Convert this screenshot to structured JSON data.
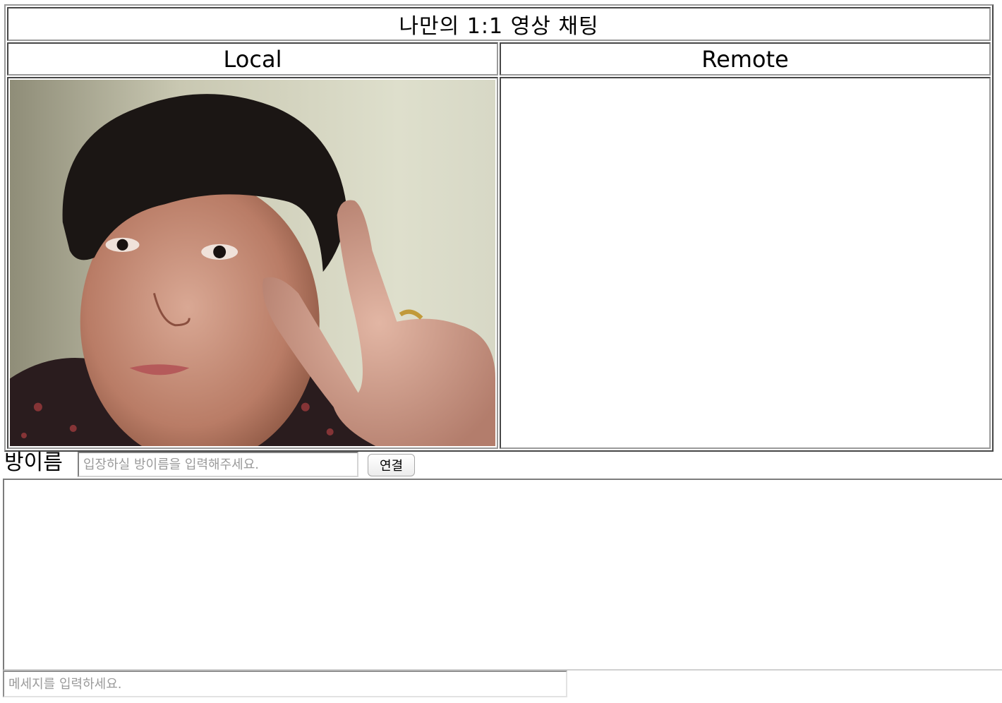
{
  "header": {
    "title": "나만의 1:1 영상 채팅"
  },
  "videos": {
    "local_label": "Local",
    "remote_label": "Remote"
  },
  "room": {
    "label": "방이름",
    "placeholder": "입장하실 방이름을 입력해주세요.",
    "value": "",
    "connect_label": "연결"
  },
  "chat": {
    "log_text": "",
    "message_placeholder": "메세지를 입력하세요.",
    "message_value": ""
  }
}
